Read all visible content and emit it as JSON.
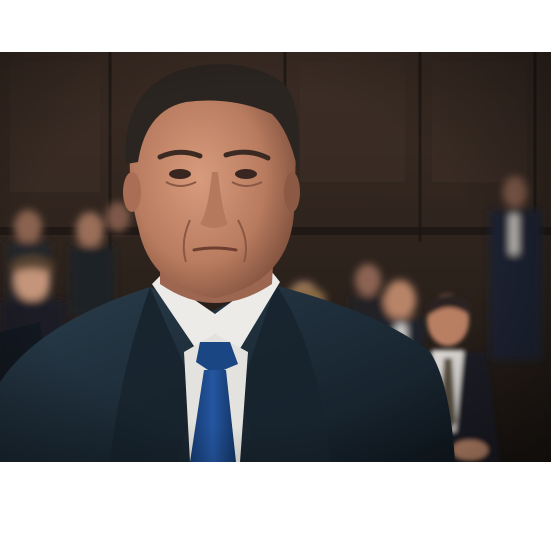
{
  "image": {
    "kind": "film-still",
    "scene": "courtroom",
    "subject": "man-in-dark-suit-blue-tie",
    "palette": {
      "wood_panel": "#3a2d25",
      "wood_dark": "#221a15",
      "suit": "#1f2f3c",
      "suit_shadow": "#121c25",
      "tie": "#1d4a8c",
      "shirt": "#e8e6e2",
      "skin": "#c98e72",
      "skin_shadow": "#8c5a44",
      "hair": "#2a2420",
      "letterbox": "#ffffff"
    }
  }
}
